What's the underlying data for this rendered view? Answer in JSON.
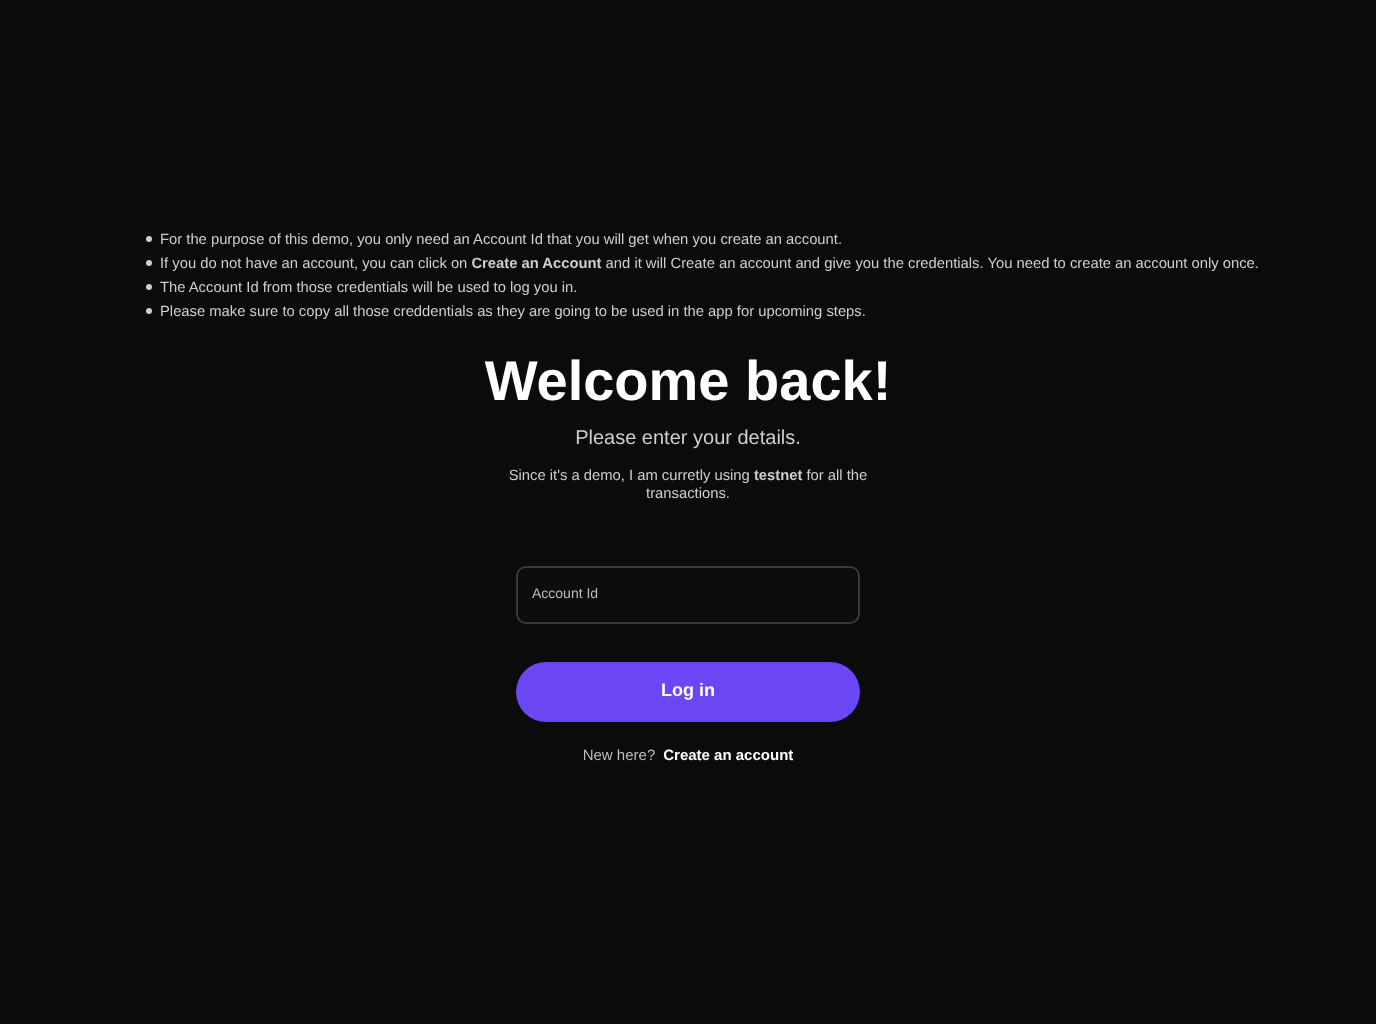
{
  "notes": [
    "For the purpose of this demo, you only need an Account Id that you will get when you create an account.",
    "If you do not have an account, you can click on **Create an Account** and it will Create an account and give you the credentials. You need to create an account only once.",
    "The Account Id from those credentials will be used to log you in.",
    "Please make sure to copy all those creddentials as they are going to be used in the app for upcoming steps."
  ],
  "title": "Welcome back!",
  "subtitle": "Please enter your details.",
  "demo_note": "Since it's a demo, I am curretly using **testnet** for all the transactions.",
  "account_field": {
    "placeholder": "Account Id"
  },
  "login_button": "Log in",
  "signup_prompt": {
    "text": "New here?",
    "link": "Create an account"
  }
}
